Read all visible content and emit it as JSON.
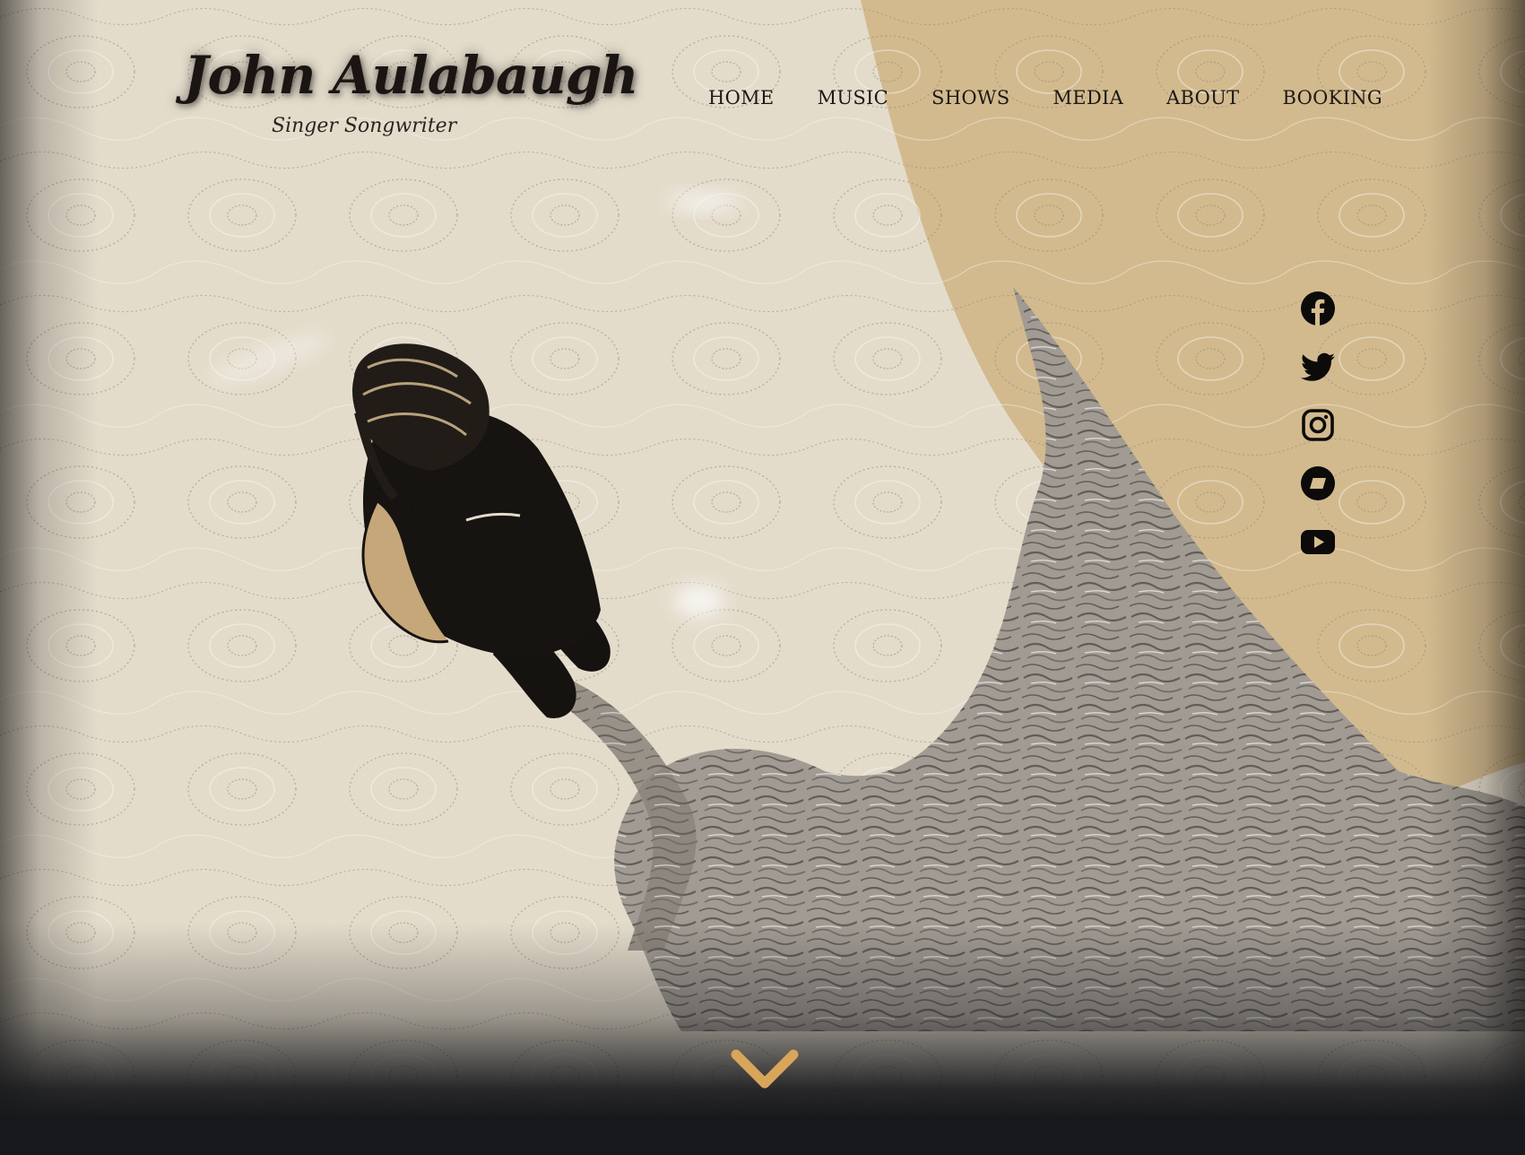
{
  "site": {
    "name": "John Aulabaugh",
    "tagline": "Singer Songwriter"
  },
  "nav": {
    "items": [
      {
        "label": "HOME"
      },
      {
        "label": "MUSIC"
      },
      {
        "label": "SHOWS"
      },
      {
        "label": "MEDIA"
      },
      {
        "label": "ABOUT"
      },
      {
        "label": "BOOKING"
      }
    ]
  },
  "social": {
    "items": [
      {
        "icon": "facebook-icon"
      },
      {
        "icon": "twitter-icon"
      },
      {
        "icon": "instagram-icon"
      },
      {
        "icon": "bandsintown-icon"
      },
      {
        "icon": "youtube-icon"
      }
    ]
  },
  "scroll_cue": {
    "icon": "chevron-down-icon"
  },
  "colors": {
    "paper": "#e9e1d1",
    "tan": "#d6bd90",
    "ink": "#1a1413",
    "accent": "#d9a55a",
    "footer": "#17181b"
  }
}
